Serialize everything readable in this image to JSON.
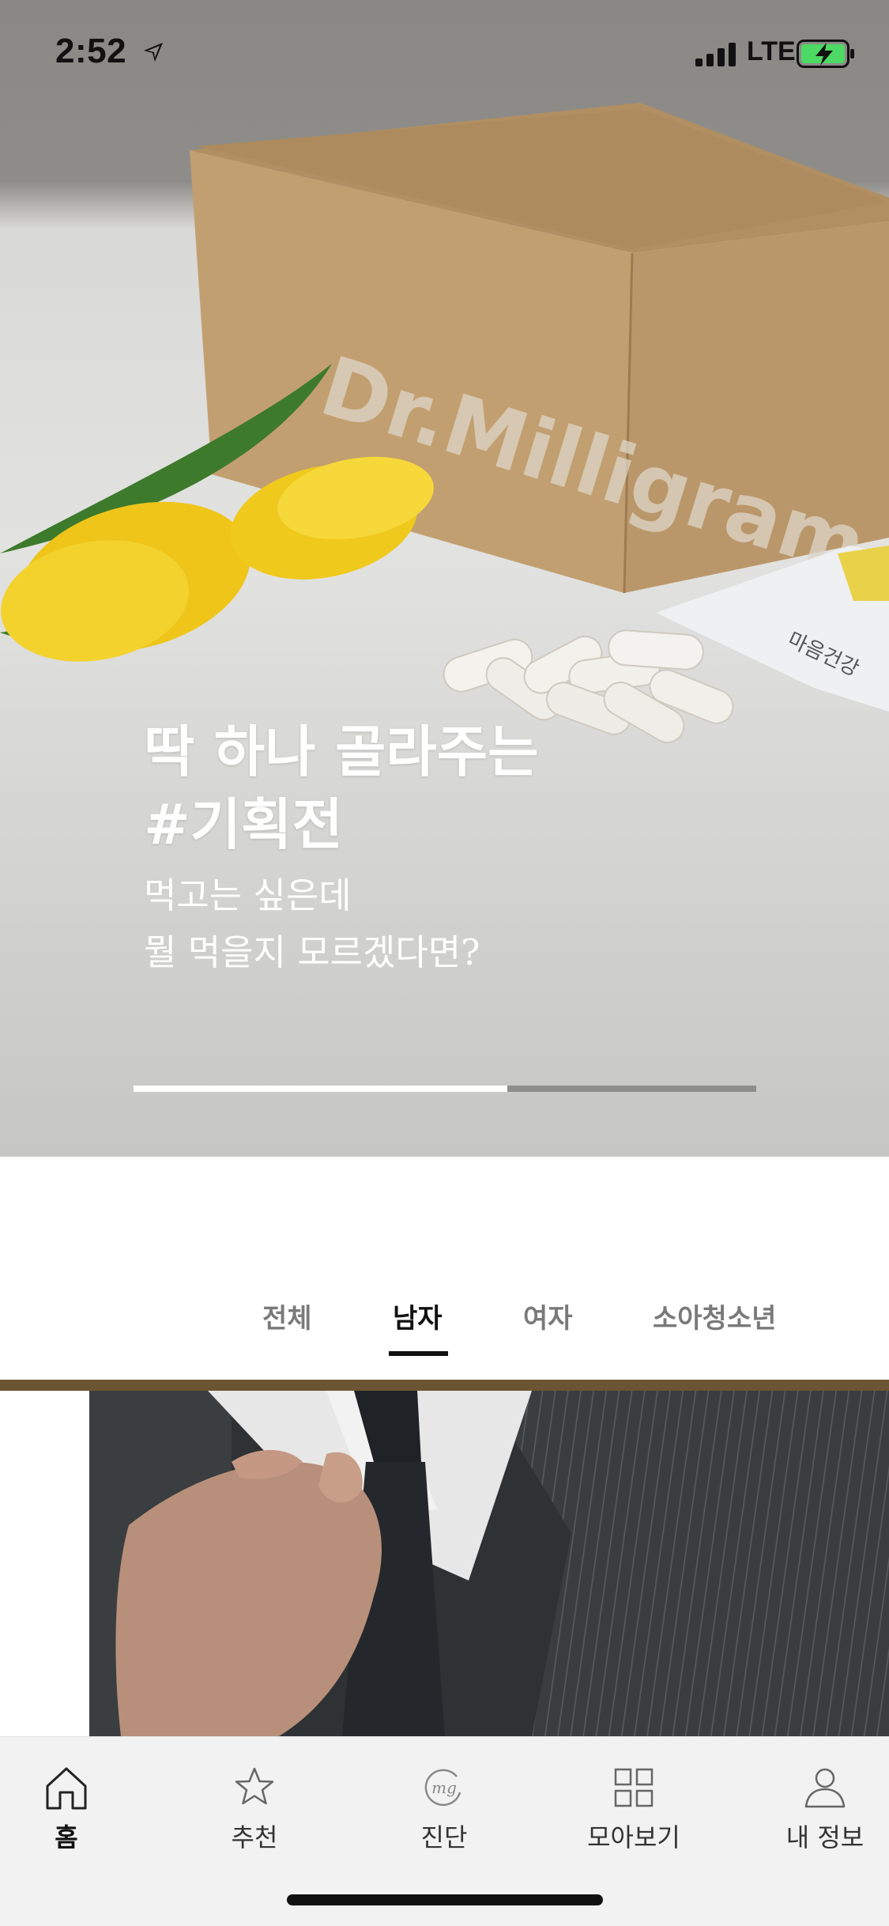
{
  "status_bar": {
    "time": "2:52",
    "network": "LTE",
    "icons": [
      "location-arrow-icon",
      "cellular-signal-icon",
      "battery-charging-icon"
    ]
  },
  "hero": {
    "box_brand": "Dr.Milligram",
    "packet_text": "마음건강",
    "title_line1": "딱 하나 골라주는",
    "title_line2": "#기획전",
    "subtitle_line1": "먹고는 싶은데",
    "subtitle_line2": "뭘 먹을지 모르겠다면?",
    "carousel_progress": 0.6
  },
  "tabs": {
    "items": [
      {
        "label": "전체",
        "active": false
      },
      {
        "label": "남자",
        "active": true
      },
      {
        "label": "여자",
        "active": false
      },
      {
        "label": "소아청소년",
        "active": false
      }
    ]
  },
  "bottom_nav": {
    "items": [
      {
        "label": "홈",
        "icon": "home-icon",
        "active": true
      },
      {
        "label": "추천",
        "icon": "star-icon",
        "active": false
      },
      {
        "label": "진단",
        "icon": "mg-logo-icon",
        "active": false
      },
      {
        "label": "모아보기",
        "icon": "grid-icon",
        "active": false
      },
      {
        "label": "내 정보",
        "icon": "person-icon",
        "active": false
      }
    ]
  },
  "colors": {
    "accent_rule": "#6b5431",
    "active_text": "#111111",
    "inactive_text": "#7a7a7a",
    "nav_background": "#f2f2f2"
  }
}
